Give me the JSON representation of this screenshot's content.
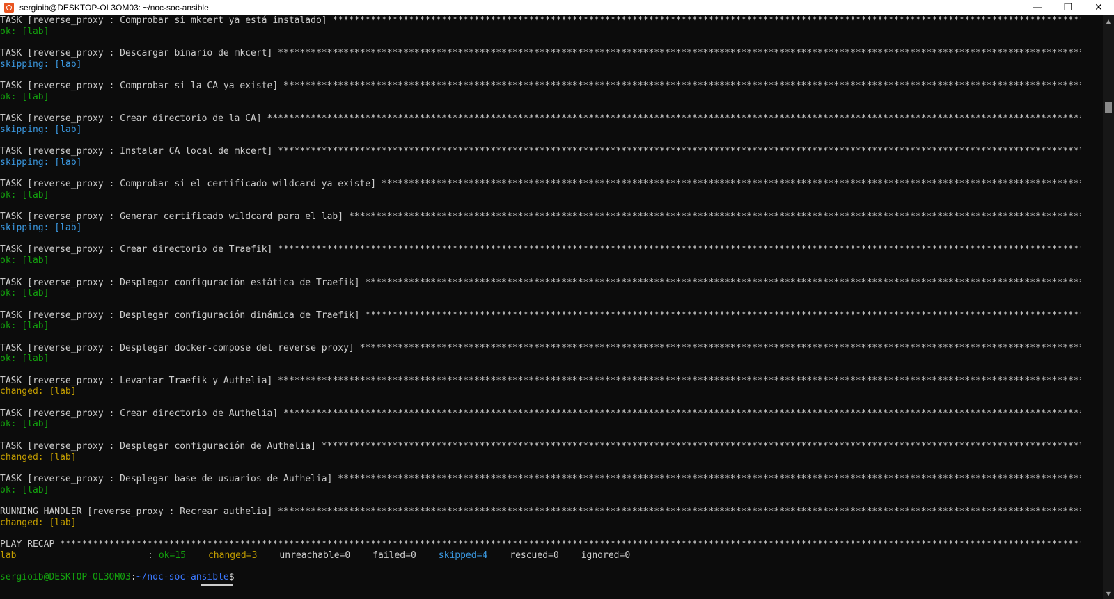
{
  "window": {
    "title": "sergioib@DESKTOP-OL3OM03: ~/noc-soc-ansible",
    "minimize_glyph": "—",
    "maximize_glyph": "❐",
    "close_glyph": "✕",
    "app_icon": "ubuntu-icon"
  },
  "terminal": {
    "stars": "*************************************************************************************************************************************************************************************************",
    "tasks": [
      {
        "label": "TASK [reverse_proxy : Comprobar si mkcert ya está instalado]",
        "status": "ok: [lab]",
        "kind": "ok"
      },
      {
        "label": "TASK [reverse_proxy : Descargar binario de mkcert]",
        "status": "skipping: [lab]",
        "kind": "skip"
      },
      {
        "label": "TASK [reverse_proxy : Comprobar si la CA ya existe]",
        "status": "ok: [lab]",
        "kind": "ok"
      },
      {
        "label": "TASK [reverse_proxy : Crear directorio de la CA]",
        "status": "skipping: [lab]",
        "kind": "skip"
      },
      {
        "label": "TASK [reverse_proxy : Instalar CA local de mkcert]",
        "status": "skipping: [lab]",
        "kind": "skip"
      },
      {
        "label": "TASK [reverse_proxy : Comprobar si el certificado wildcard ya existe]",
        "status": "ok: [lab]",
        "kind": "ok"
      },
      {
        "label": "TASK [reverse_proxy : Generar certificado wildcard para el lab]",
        "status": "skipping: [lab]",
        "kind": "skip"
      },
      {
        "label": "TASK [reverse_proxy : Crear directorio de Traefik]",
        "status": "ok: [lab]",
        "kind": "ok"
      },
      {
        "label": "TASK [reverse_proxy : Desplegar configuración estática de Traefik]",
        "status": "ok: [lab]",
        "kind": "ok"
      },
      {
        "label": "TASK [reverse_proxy : Desplegar configuración dinámica de Traefik]",
        "status": "ok: [lab]",
        "kind": "ok"
      },
      {
        "label": "TASK [reverse_proxy : Desplegar docker-compose del reverse proxy]",
        "status": "ok: [lab]",
        "kind": "ok"
      },
      {
        "label": "TASK [reverse_proxy : Levantar Traefik y Authelia]",
        "status": "changed: [lab]",
        "kind": "chg"
      },
      {
        "label": "TASK [reverse_proxy : Crear directorio de Authelia]",
        "status": "ok: [lab]",
        "kind": "ok"
      },
      {
        "label": "TASK [reverse_proxy : Desplegar configuración de Authelia]",
        "status": "changed: [lab]",
        "kind": "chg"
      },
      {
        "label": "TASK [reverse_proxy : Desplegar base de usuarios de Authelia]",
        "status": "ok: [lab]",
        "kind": "ok"
      },
      {
        "label": "RUNNING HANDLER [reverse_proxy : Recrear authelia]",
        "status": "changed: [lab]",
        "kind": "chg"
      }
    ],
    "recap": {
      "header": "PLAY RECAP",
      "host": "lab",
      "colon": ":",
      "ok": "ok=15",
      "changed": "changed=3",
      "unreachable": "unreachable=0",
      "failed": "failed=0",
      "skipped": "skipped=4",
      "rescued": "rescued=0",
      "ignored": "ignored=0"
    },
    "prompt": {
      "user_host": "sergioib@DESKTOP-OL3OM03",
      "sep": ":",
      "path": "~/noc-soc-ansible",
      "symbol": "$"
    }
  },
  "colors": {
    "background": "#0c0c0c",
    "text": "#cccccc",
    "ok": "#13a10e",
    "skipping": "#3a96dd",
    "changed": "#c19c00",
    "path": "#3b78ff"
  }
}
